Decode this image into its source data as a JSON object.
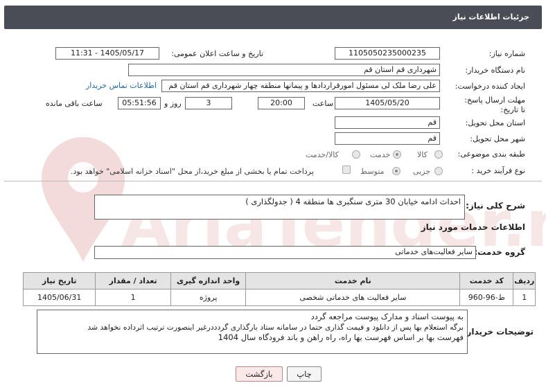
{
  "header": {
    "title": "جزئیات اطلاعات نیاز"
  },
  "form": {
    "need_number": {
      "label": "شماره نیاز:",
      "value": "1105050235000235"
    },
    "announce_datetime": {
      "label": "تاریخ و ساعت اعلان عمومی:",
      "value": "1405/05/17 - 11:31"
    },
    "buyer_org": {
      "label": "نام دستگاه خریدار:",
      "value": "شهرداری قم استان قم"
    },
    "requester": {
      "label": "ایجاد کننده درخواست:",
      "value": "علی رضا ملک لی مسئول امورقراردادها و پیمانها منطقه چهار  شهرداری قم استان قم",
      "contact_link": "اطلاعات تماس خریدار"
    },
    "deadline": {
      "label": "مهلت ارسال پاسخ: تا تاریخ:",
      "date": "1405/05/20",
      "time_label": "ساعت",
      "time": "20:00",
      "days_value": "3",
      "days_label": "روز و",
      "remaining_time": "05:51:56",
      "remaining_label": "ساعت باقی مانده"
    },
    "province": {
      "label": "استان محل تحویل:",
      "value": "قم"
    },
    "city": {
      "label": "شهر محل تحویل:",
      "value": "قم"
    },
    "category": {
      "label": "طبقه بندی موضوعی:",
      "options": [
        "کالا",
        "خدمت",
        "کالا/خدمت"
      ],
      "selected": "خدمت"
    },
    "process_type": {
      "label": "نوع فرآیند خرید :",
      "options": [
        "جزیی",
        "متوسط"
      ],
      "selected": "متوسط",
      "treasury_note": "پرداخت تمام یا بخشی از مبلغ خرید،از محل \"اسناد خزانه اسلامی\" خواهد بود."
    }
  },
  "description": {
    "label": "شرح کلی نیاز:",
    "value": "احداث ادامه خیابان 30 متری سنگبری ها منطقه 4 ( جدولگذاری )"
  },
  "services_section": {
    "title": "اطلاعات خدمات مورد نیاز"
  },
  "service_group": {
    "label": "گروه خدمت:",
    "value": "سایر فعالیت‌های خدماتی"
  },
  "table": {
    "headers": [
      "ردیف",
      "کد خدمت",
      "نام خدمت",
      "واحد اندازه گیری",
      "تعداد / مقدار",
      "تاریخ نیاز"
    ],
    "rows": [
      [
        "1",
        "ط-96-960",
        "سایر فعالیت های خدماتی شخصی",
        "پروژه",
        "1",
        "1405/06/31"
      ]
    ]
  },
  "buyer_notes": {
    "label": "توضیحات خریدار:",
    "lines": [
      "به پیوست اسناد و مدارک پیوست مراجعه گردد",
      "برگه استعلام بها پس از دانلود و قیمت گذاری حتما در سامانه ستاد بارگذاری گردددرغیر اینصورت ترتیب اثرداده نخواهد شد",
      "فهرست بها بر اساس فهرست بها راه، راه راهن و باند فرودگاه سال 1404"
    ]
  },
  "buttons": {
    "print": "چاپ",
    "back": "بازگشت"
  },
  "watermark": {
    "text": "AriaTender.net",
    "color": "#e8c8c8"
  },
  "colors": {
    "header_bg": "#4a4d56",
    "link": "#1d69a6",
    "back_button_bg": "#fbe8e8"
  }
}
